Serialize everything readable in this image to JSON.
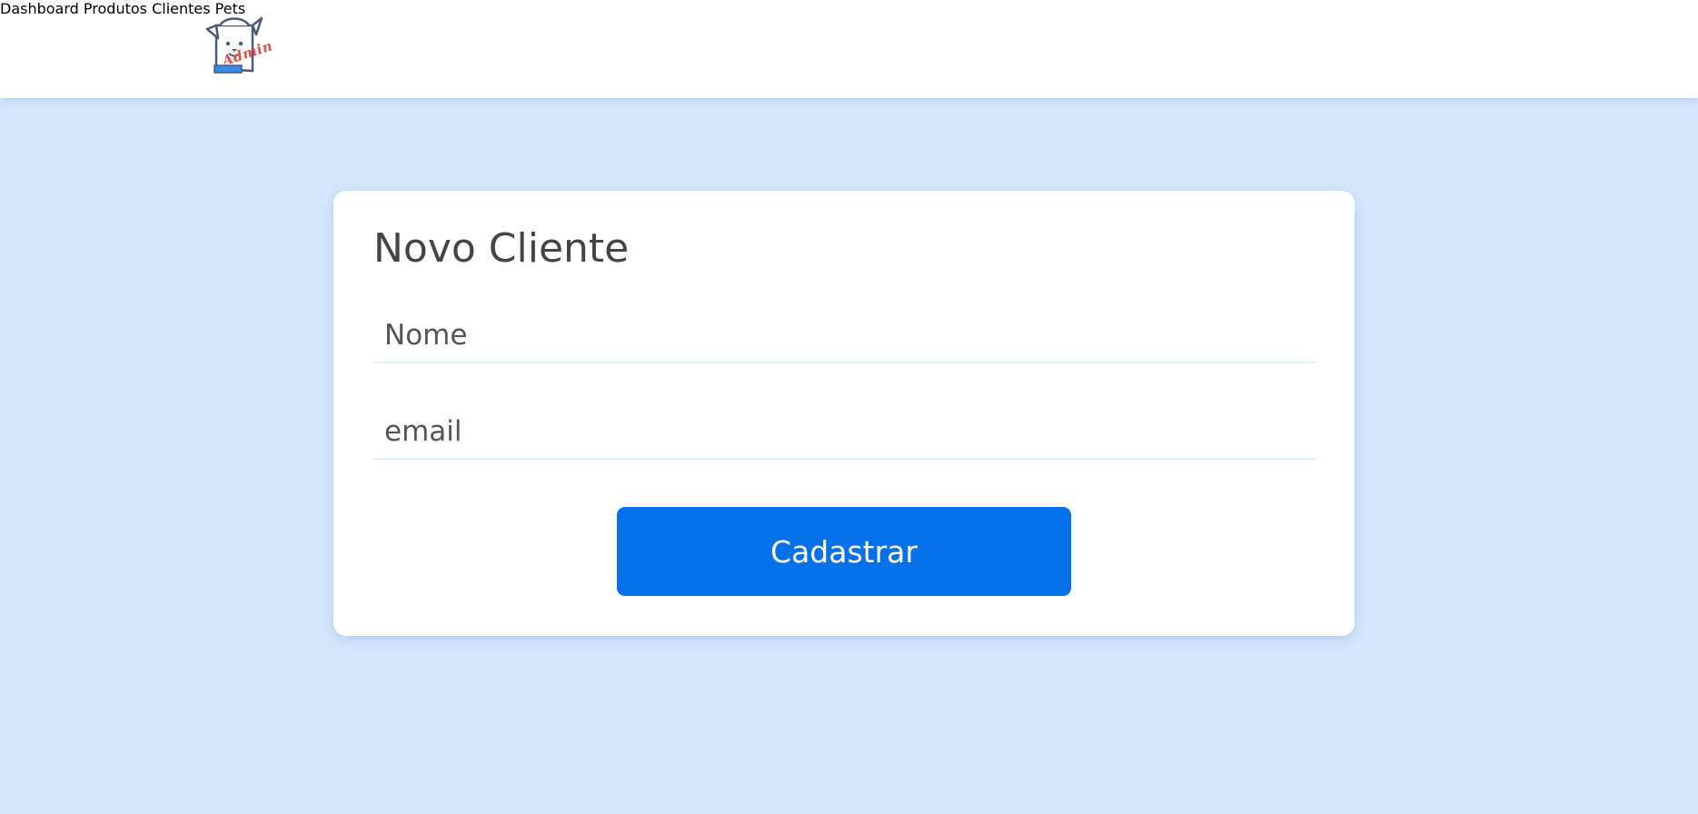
{
  "header": {
    "logo_text": "Admin",
    "nav": [
      {
        "label": "Dashboard"
      },
      {
        "label": "Produtos"
      },
      {
        "label": "Clientes"
      },
      {
        "label": "Pets"
      }
    ]
  },
  "form": {
    "title": "Novo Cliente",
    "name_field": {
      "placeholder": "Nome",
      "value": ""
    },
    "email_field": {
      "placeholder": "email",
      "value": ""
    },
    "submit_label": "Cadastrar"
  },
  "colors": {
    "background": "#d4e7fd",
    "header": "#ffffff",
    "card": "#ffffff",
    "primary": "#0570ea",
    "logo_accent": "#e5504a",
    "text": "#444444"
  }
}
